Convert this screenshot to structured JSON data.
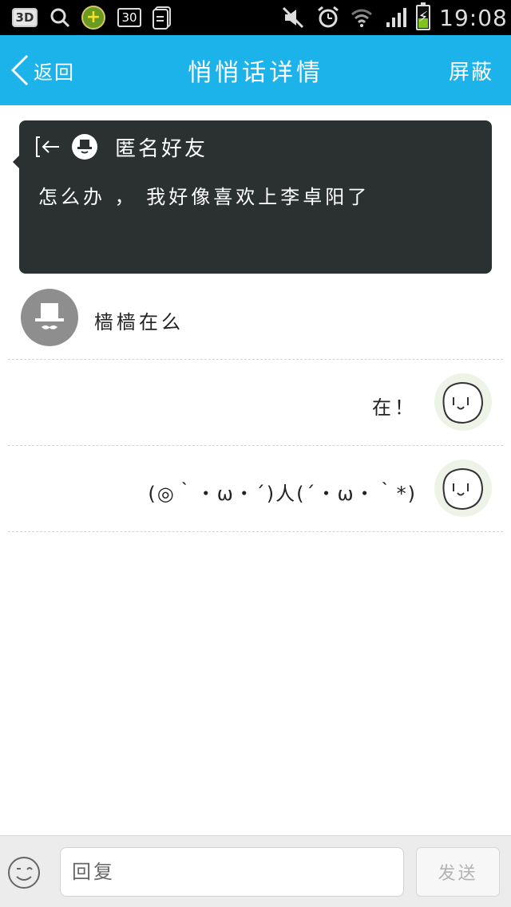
{
  "status_bar": {
    "badge_3d": "3D",
    "calendar_day": "30",
    "time": "19:08",
    "icons": [
      "3d-badge-icon",
      "search-icon",
      "plus-app-icon",
      "calendar-icon",
      "document-icon",
      "mute-icon",
      "alarm-icon",
      "wifi-icon",
      "signal-icon",
      "battery-charging-icon"
    ]
  },
  "header": {
    "back_label": "返回",
    "title": "悄悄话详情",
    "block_label": "屏蔽"
  },
  "message": {
    "sender_name": "匿名好友",
    "content": "怎么办 ， 我好像喜欢上李卓阳了"
  },
  "replies": [
    {
      "side": "left",
      "text": "樯樯在么"
    },
    {
      "side": "right",
      "text": "在！"
    },
    {
      "side": "right",
      "text": "(◎｀・ω・´)人(´・ω・｀*)"
    }
  ],
  "input": {
    "placeholder": "回复",
    "value": "",
    "send_label": "发送"
  },
  "colors": {
    "accent": "#1cb3ea",
    "card_bg": "#2b3131",
    "status_bg": "#000000"
  }
}
